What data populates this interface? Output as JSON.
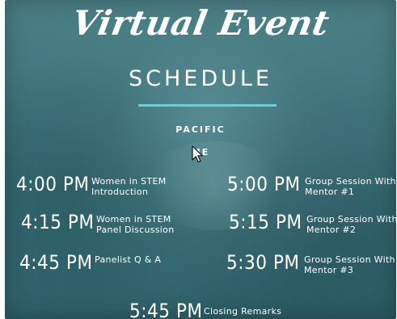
{
  "header": {
    "script_title": "Virtual Event",
    "main_title": "SCHEDULE",
    "timezone_line_1": "PACIFIC",
    "timezone_line_2": "ME"
  },
  "schedule": {
    "left": [
      {
        "time": "4:00 PM",
        "description": "Women in STEM\nIntroduction"
      },
      {
        "time": "4:15 PM",
        "description": "Women in STEM\nPanel Discussion"
      },
      {
        "time": "4:45 PM",
        "description": "Panelist Q & A"
      }
    ],
    "right": [
      {
        "time": "5:00 PM",
        "description": "Group Session With\nMentor #1"
      },
      {
        "time": "5:15 PM",
        "description": "Group Session With\nMentor #2"
      },
      {
        "time": "5:30 PM",
        "description": "Group Session With\nMentor #3"
      }
    ],
    "center": {
      "time": "5:45 PM",
      "description": "Closing Remarks"
    }
  },
  "colors": {
    "background": "#3f747b",
    "accent": "#59d7db",
    "text": "#ffffff"
  },
  "icons": {
    "cursor": "mouse-pointer-icon"
  }
}
